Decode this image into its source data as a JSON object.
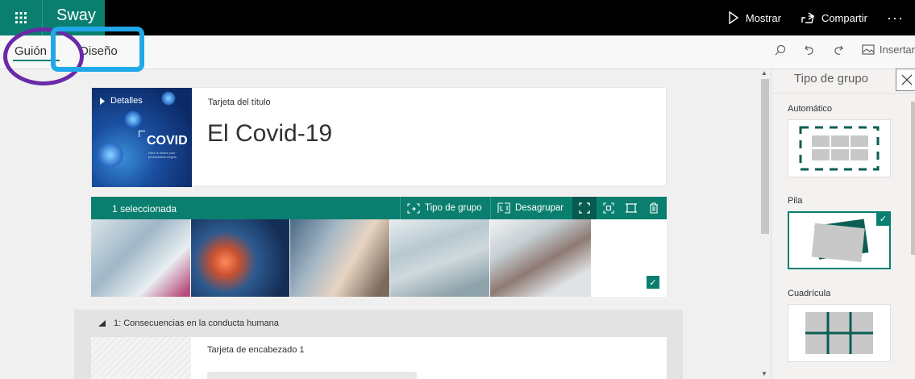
{
  "app": {
    "name": "Sway"
  },
  "topbar": {
    "play_label": "Mostrar",
    "share_label": "Compartir",
    "more_label": "···"
  },
  "tabs": [
    {
      "label": "Guión"
    },
    {
      "label": "Diseño"
    }
  ],
  "tools": {
    "insert_label": "Insertar"
  },
  "title_card": {
    "details_label": "Detalles",
    "card_type": "Tarjeta del título",
    "title": "El Covid-19",
    "cover_text": "COVID",
    "cover_subtext": "Here is where your presentation begins"
  },
  "group_card": {
    "selection_label": "1 seleccionada",
    "group_type_label": "Tipo de grupo",
    "ungroup_label": "Desagrupar",
    "photos": [
      {
        "name": "medical-staff-photo",
        "color": "#cfd8dc"
      },
      {
        "name": "virus-photo",
        "color": "#1d3f6e"
      },
      {
        "name": "test-swab-photo",
        "color": "#6f8aa0"
      },
      {
        "name": "hospital-worker-photo",
        "color": "#b9c7cc"
      },
      {
        "name": "patient-care-photo",
        "color": "#d7dadd"
      }
    ]
  },
  "section": {
    "header": "1: Consecuencias en la conducta humana",
    "card_type": "Tarjeta de encabezado 1"
  },
  "panel": {
    "title": "Tipo de grupo",
    "options": [
      {
        "label": "Automático",
        "selected": false
      },
      {
        "label": "Pila",
        "selected": true
      },
      {
        "label": "Cuadrícula",
        "selected": false
      }
    ]
  },
  "colors": {
    "accent": "#0a7f6f",
    "annotation_circle": "#6a2aa8",
    "annotation_rect": "#21a8e8"
  }
}
